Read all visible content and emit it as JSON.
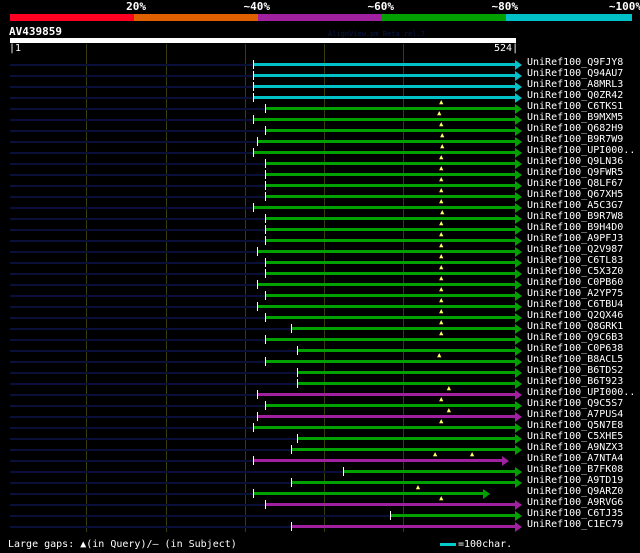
{
  "scale": {
    "labels": [
      "20%",
      "~40%",
      "~60%",
      "~80%",
      "~100%"
    ],
    "colors": [
      "#ff0022",
      "#e06000",
      "#a020a0",
      "#00a000",
      "#00c0c8"
    ]
  },
  "query": {
    "name": "AV439859",
    "start": "1",
    "end": "524",
    "version": "AlignView.pm Beta rel.7"
  },
  "colors": {
    "cyan": "#00c0c8",
    "green": "#00a000",
    "magenta": "#a020a0"
  },
  "hits": [
    {
      "label": "UniRef100_Q9FJY8",
      "color": "cyan",
      "from": 0.48,
      "to": 1,
      "gaps": []
    },
    {
      "label": "UniRef100_Q94AU7",
      "color": "cyan",
      "from": 0.48,
      "to": 1,
      "gaps": []
    },
    {
      "label": "UniRef100_A8MRL3",
      "color": "cyan",
      "from": 0.48,
      "to": 1,
      "gaps": []
    },
    {
      "label": "UniRef100_Q0ZR42",
      "color": "cyan",
      "from": 0.48,
      "to": 1,
      "gaps": []
    },
    {
      "label": "UniRef100_C6TKS1",
      "color": "green",
      "from": 0.504,
      "to": 1,
      "gaps": [
        0.854
      ]
    },
    {
      "label": "UniRef100_B9MXM5",
      "color": "green",
      "from": 0.48,
      "to": 1,
      "gaps": [
        0.85
      ]
    },
    {
      "label": "UniRef100_Q682H9",
      "color": "green",
      "from": 0.504,
      "to": 1,
      "gaps": [
        0.854
      ]
    },
    {
      "label": "UniRef100_B9R7W9",
      "color": "green",
      "from": 0.488,
      "to": 1,
      "gaps": [
        0.856
      ]
    },
    {
      "label": "UniRef100_UPI000..",
      "color": "green",
      "from": 0.48,
      "to": 1,
      "gaps": [
        0.856
      ]
    },
    {
      "label": "UniRef100_Q9LN36",
      "color": "green",
      "from": 0.504,
      "to": 1,
      "gaps": [
        0.854
      ]
    },
    {
      "label": "UniRef100_Q9FWR5",
      "color": "green",
      "from": 0.504,
      "to": 1,
      "gaps": [
        0.854
      ]
    },
    {
      "label": "UniRef100_Q8LF67",
      "color": "green",
      "from": 0.504,
      "to": 1,
      "gaps": [
        0.854
      ]
    },
    {
      "label": "UniRef100_Q67XH5",
      "color": "green",
      "from": 0.504,
      "to": 1,
      "gaps": [
        0.854
      ]
    },
    {
      "label": "UniRef100_A5C3G7",
      "color": "green",
      "from": 0.48,
      "to": 1,
      "gaps": [
        0.854
      ]
    },
    {
      "label": "UniRef100_B9R7W8",
      "color": "green",
      "from": 0.504,
      "to": 1,
      "gaps": [
        0.856
      ]
    },
    {
      "label": "UniRef100_B9H4D0",
      "color": "green",
      "from": 0.504,
      "to": 1,
      "gaps": [
        0.854
      ]
    },
    {
      "label": "UniRef100_A9PFJ3",
      "color": "green",
      "from": 0.504,
      "to": 1,
      "gaps": [
        0.854
      ]
    },
    {
      "label": "UniRef100_Q2V987",
      "color": "green",
      "from": 0.488,
      "to": 1,
      "gaps": [
        0.854
      ]
    },
    {
      "label": "UniRef100_C6TL83",
      "color": "green",
      "from": 0.504,
      "to": 1,
      "gaps": [
        0.854
      ]
    },
    {
      "label": "UniRef100_C5X3Z0",
      "color": "green",
      "from": 0.504,
      "to": 1,
      "gaps": [
        0.854
      ]
    },
    {
      "label": "UniRef100_C0PB60",
      "color": "green",
      "from": 0.488,
      "to": 1,
      "gaps": [
        0.854
      ]
    },
    {
      "label": "UniRef100_A2YP75",
      "color": "green",
      "from": 0.504,
      "to": 1,
      "gaps": [
        0.854
      ]
    },
    {
      "label": "UniRef100_C6TBU4",
      "color": "green",
      "from": 0.488,
      "to": 1,
      "gaps": [
        0.854
      ]
    },
    {
      "label": "UniRef100_Q2QX46",
      "color": "green",
      "from": 0.504,
      "to": 1,
      "gaps": [
        0.854
      ]
    },
    {
      "label": "UniRef100_Q8GRK1",
      "color": "green",
      "from": 0.555,
      "to": 1,
      "gaps": [
        0.854
      ]
    },
    {
      "label": "UniRef100_Q9C6B3",
      "color": "green",
      "from": 0.504,
      "to": 1,
      "gaps": [
        0.854
      ]
    },
    {
      "label": "UniRef100_C0P638",
      "color": "green",
      "from": 0.567,
      "to": 1,
      "gaps": []
    },
    {
      "label": "UniRef100_B8ACL5",
      "color": "green",
      "from": 0.504,
      "to": 1,
      "gaps": [
        0.85
      ]
    },
    {
      "label": "UniRef100_B6TDS2",
      "color": "green",
      "from": 0.567,
      "to": 1,
      "gaps": []
    },
    {
      "label": "UniRef100_B6T923",
      "color": "green",
      "from": 0.567,
      "to": 1,
      "gaps": []
    },
    {
      "label": "UniRef100_UPI000..",
      "color": "magenta",
      "from": 0.488,
      "to": 1,
      "gaps": [
        0.869
      ]
    },
    {
      "label": "UniRef100_Q9C5S7",
      "color": "green",
      "from": 0.504,
      "to": 1,
      "gaps": [
        0.854
      ]
    },
    {
      "label": "UniRef100_A7PUS4",
      "color": "magenta",
      "from": 0.488,
      "to": 1,
      "gaps": [
        0.869
      ]
    },
    {
      "label": "UniRef100_Q5N7E8",
      "color": "green",
      "from": 0.48,
      "to": 1,
      "gaps": [
        0.854
      ]
    },
    {
      "label": "UniRef100_C5XHE5",
      "color": "green",
      "from": 0.567,
      "to": 1,
      "gaps": []
    },
    {
      "label": "UniRef100_A9NZX3",
      "color": "green",
      "from": 0.555,
      "to": 1,
      "gaps": []
    },
    {
      "label": "UniRef100_A7NTA4",
      "color": "magenta",
      "from": 0.48,
      "to": 0.974,
      "gaps": [
        0.842,
        0.915
      ]
    },
    {
      "label": "UniRef100_B7FK08",
      "color": "green",
      "from": 0.658,
      "to": 1,
      "gaps": []
    },
    {
      "label": "UniRef100_A9TD19",
      "color": "green",
      "from": 0.555,
      "to": 1,
      "gaps": []
    },
    {
      "label": "UniRef100_Q9ARZ0",
      "color": "green",
      "from": 0.48,
      "to": 0.937,
      "gaps": [
        0.808
      ]
    },
    {
      "label": "UniRef100_A9RVG6",
      "color": "magenta",
      "from": 0.504,
      "to": 1,
      "gaps": [
        0.854
      ]
    },
    {
      "label": "UniRef100_C6TJ35",
      "color": "green",
      "from": 0.751,
      "to": 1,
      "gaps": []
    },
    {
      "label": "UniRef100_C1EC79",
      "color": "magenta",
      "from": 0.555,
      "to": 1,
      "gaps": []
    }
  ],
  "footer": {
    "gaps_text": "Large gaps: ▲(in Query)/– (in Subject)",
    "legend": "=100char."
  }
}
